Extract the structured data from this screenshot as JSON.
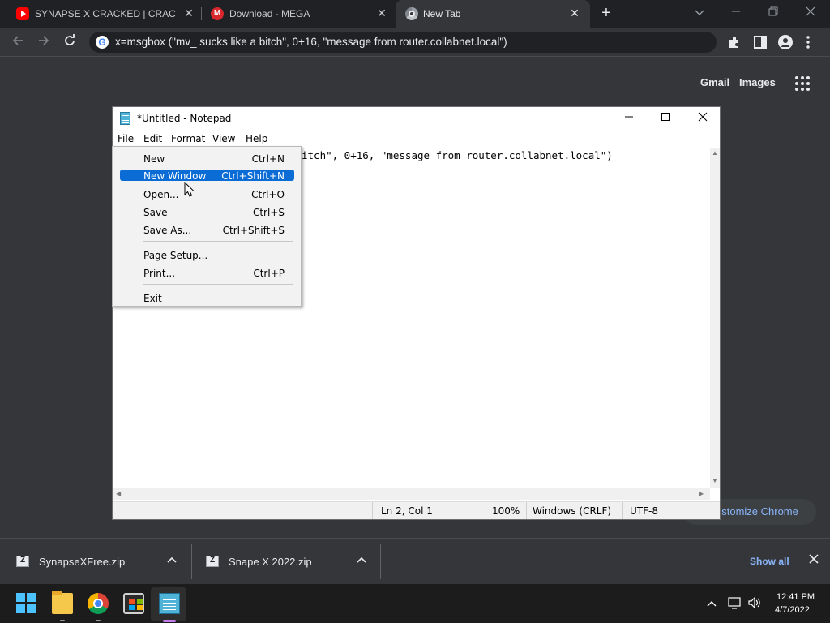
{
  "browser": {
    "tabs": [
      {
        "title": "SYNAPSE X CRACKED | CRACKED",
        "favicon": "youtube-icon"
      },
      {
        "title": "Download - MEGA",
        "favicon": "mega-icon"
      },
      {
        "title": "New Tab",
        "favicon": "chrome-icon",
        "active": true
      }
    ],
    "new_tab_label": "+",
    "close_glyph": "✕",
    "address": "x=msgbox (\"mv_ sucks like a bitch\", 0+16, \"message from router.collabnet.local\")",
    "ntp_links": {
      "gmail": "Gmail",
      "images": "Images"
    },
    "customize_label": "ustomize Chrome"
  },
  "notepad": {
    "title": "*Untitled - Notepad",
    "menus": [
      "File",
      "Edit",
      "Format",
      "View",
      "Help"
    ],
    "text_visible": "itch\", 0+16, \"message from router.collabnet.local\")",
    "status": {
      "position": "Ln 2, Col 1",
      "zoom": "100%",
      "line_ending": "Windows (CRLF)",
      "encoding": "UTF-8"
    }
  },
  "file_menu": {
    "items": [
      {
        "label": "New",
        "shortcut": "Ctrl+N"
      },
      {
        "label": "New Window",
        "shortcut": "Ctrl+Shift+N",
        "highlighted": true
      },
      {
        "label": "Open...",
        "shortcut": "Ctrl+O"
      },
      {
        "label": "Save",
        "shortcut": "Ctrl+S"
      },
      {
        "label": "Save As...",
        "shortcut": "Ctrl+Shift+S"
      },
      {
        "label": "Page Setup...",
        "shortcut": ""
      },
      {
        "label": "Print...",
        "shortcut": "Ctrl+P"
      },
      {
        "label": "Exit",
        "shortcut": ""
      }
    ]
  },
  "downloads": {
    "items": [
      {
        "name": "SynapseXFree.zip"
      },
      {
        "name": "Snape X 2022.zip"
      }
    ],
    "show_all": "Show all"
  },
  "taskbar": {
    "time": "12:41 PM",
    "date": "4/7/2022"
  },
  "colors": {
    "chrome_dark": "#35363a",
    "tab_strip": "#202124",
    "menu_highlight": "#0b6cd6",
    "link_blue": "#8ab4f8",
    "taskbar": "#1c1c1c"
  }
}
